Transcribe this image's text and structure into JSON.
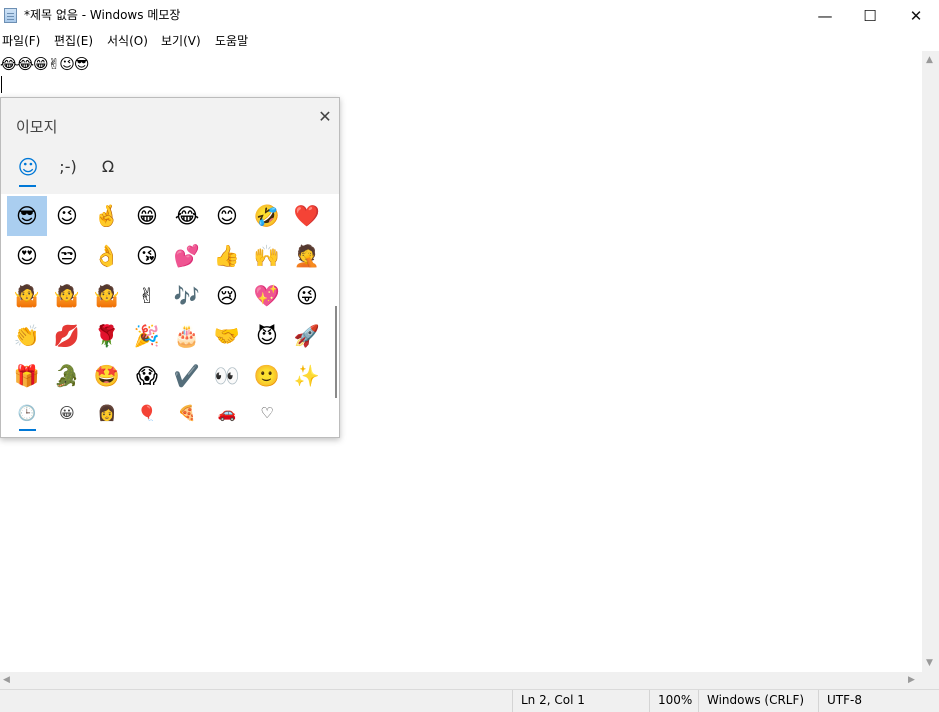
{
  "window": {
    "title": "*제목 없음 - Windows 메모장",
    "minimize_glyph": "—",
    "maximize_glyph": "☐",
    "close_glyph": "✕"
  },
  "menu": [
    "파일(F)",
    "편집(E)",
    "서식(O)",
    "보기(V)",
    "도움말"
  ],
  "editor": {
    "line1": "😂😂😁✌😉😎"
  },
  "scrollbars": {
    "up": "▲",
    "down": "▼",
    "left": "◀",
    "right": "▶"
  },
  "status": {
    "position": "Ln 2, Col 1",
    "zoom": "100%",
    "line_ending": "Windows (CRLF)",
    "encoding": "UTF-8"
  },
  "emoji_panel": {
    "title": "이모지",
    "close_glyph": "✕",
    "tabs": [
      "☺",
      ";-)",
      "Ω"
    ],
    "grid": [
      [
        "😎",
        "😉",
        "🤞",
        "😁",
        "😂",
        "😊",
        "🤣",
        "❤️"
      ],
      [
        "😍",
        "😒",
        "👌",
        "😘",
        "💕",
        "👍",
        "🙌",
        "🤦"
      ],
      [
        "🤷",
        "🤷",
        "🤷",
        "✌",
        "🎶",
        "😢",
        "💖",
        "😜"
      ],
      [
        "👏",
        "💋",
        "🌹",
        "🎉",
        "🎂",
        "🤝",
        "😈",
        "🚀"
      ],
      [
        "🎁",
        "🐊",
        "🤩",
        "😱",
        "✔️",
        "👀",
        "🙂",
        "✨"
      ]
    ],
    "categories": [
      "🕒",
      "😀",
      "👩",
      "🎈",
      "🍕",
      "🚗",
      "♡"
    ]
  },
  "colors": {
    "accent": "#0078d7",
    "selection": "#aacef0",
    "panel_bg": "#f2f2f2",
    "chrome_bg": "#f0f0f0"
  }
}
